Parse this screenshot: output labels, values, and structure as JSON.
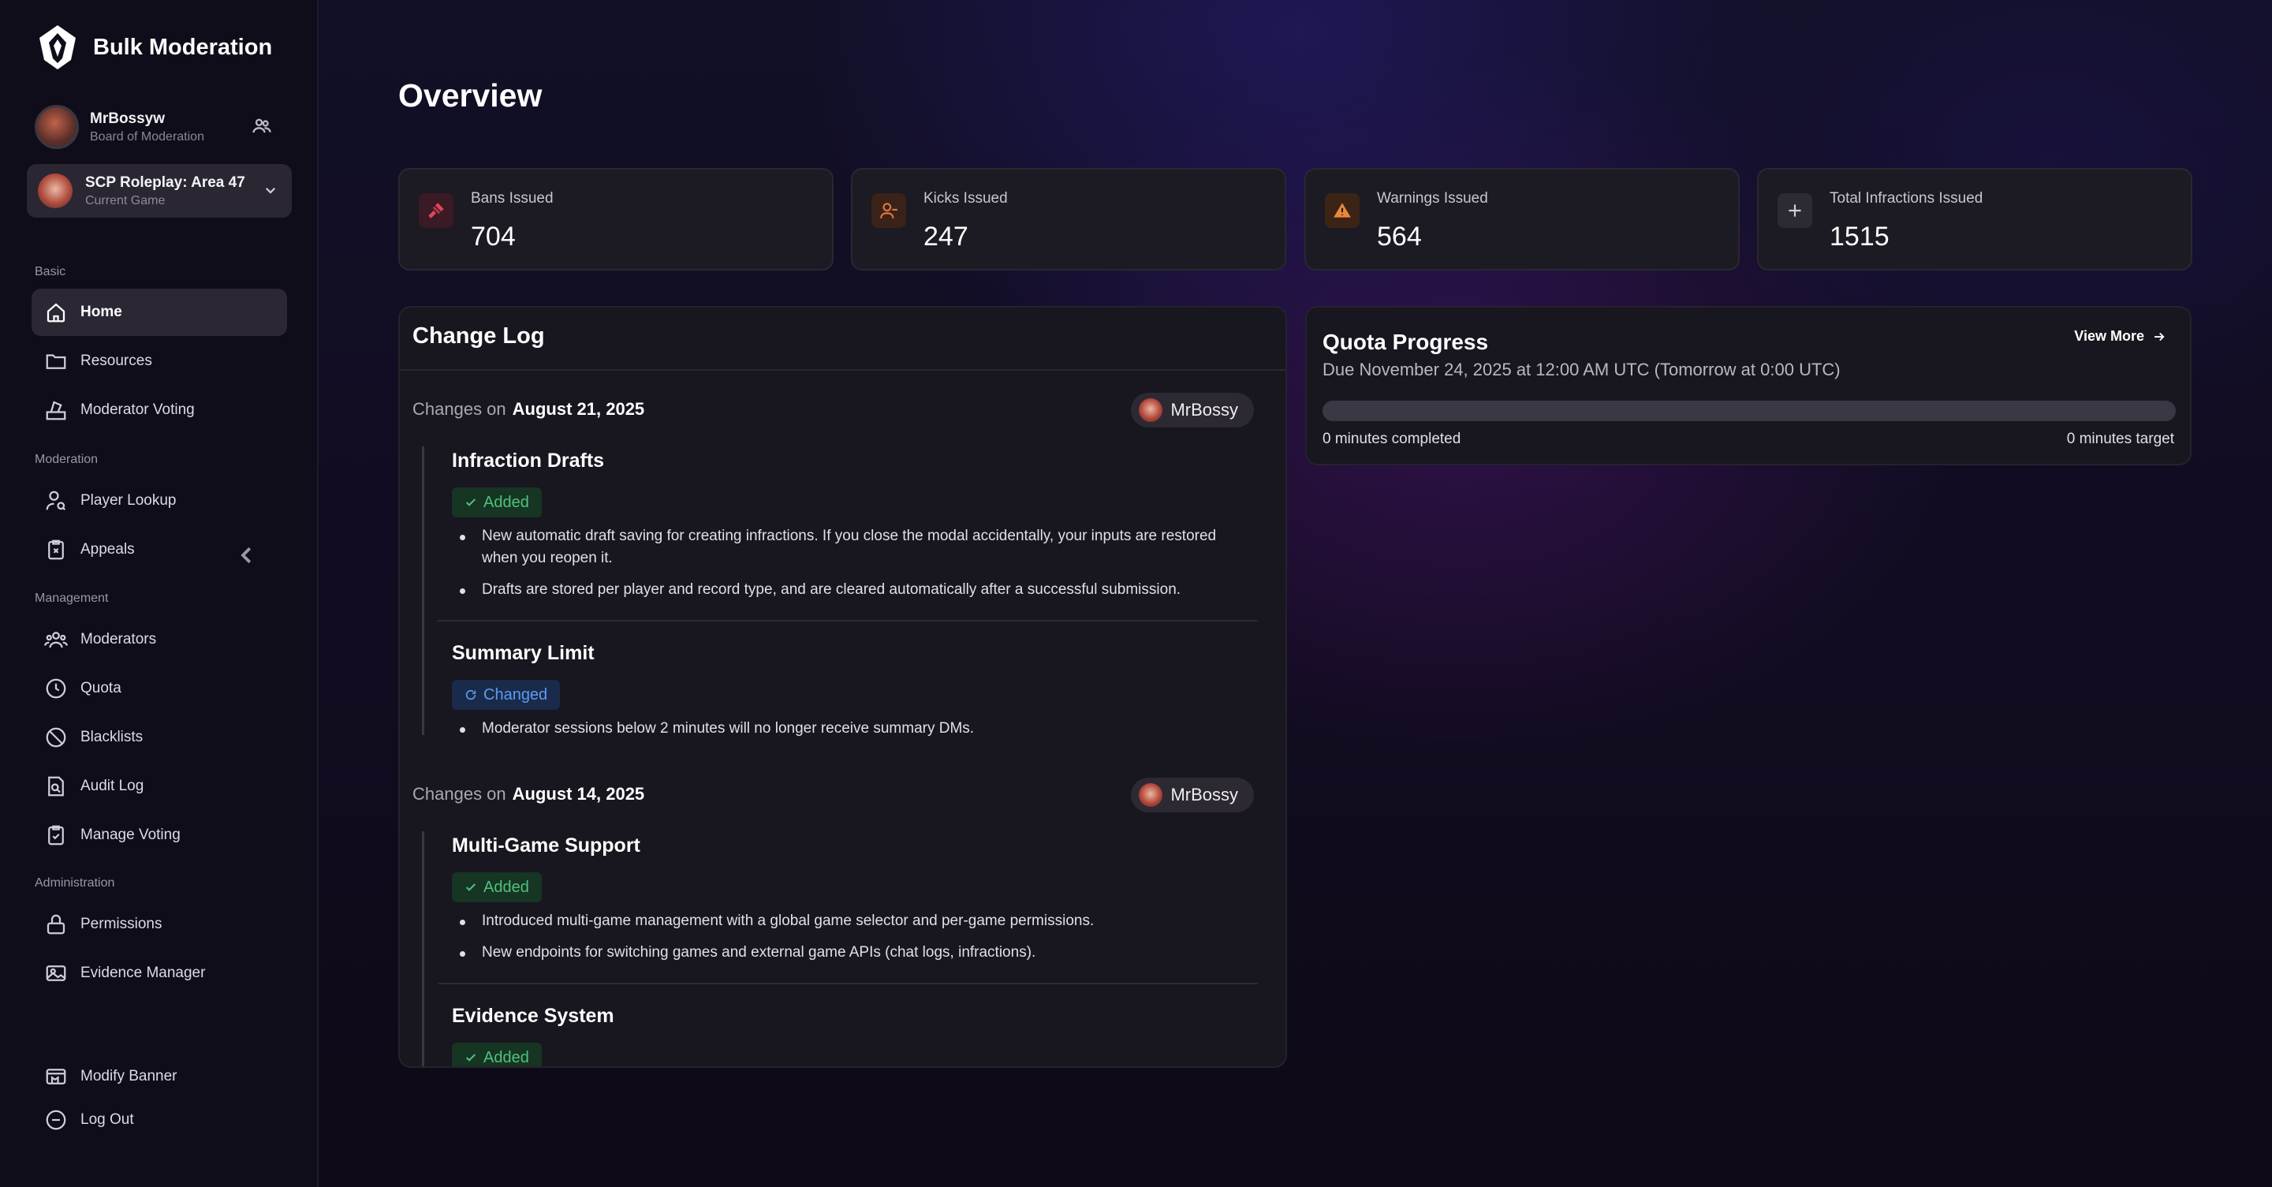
{
  "brand": {
    "name": "Bulk Moderation"
  },
  "user": {
    "name": "MrBossyw",
    "role": "Board of Moderation"
  },
  "game": {
    "title": "SCP Roleplay: Area 47",
    "subtitle": "Current Game"
  },
  "sidebar": {
    "sections": [
      "Basic",
      "Moderation",
      "Management",
      "Administration"
    ],
    "items": [
      {
        "label": "Home",
        "icon": "home-icon",
        "active": true
      },
      {
        "label": "Resources",
        "icon": "folder-icon"
      },
      {
        "label": "Moderator Voting",
        "icon": "ballot-box-icon"
      },
      {
        "label": "Player Lookup",
        "icon": "user-search-icon"
      },
      {
        "label": "Appeals",
        "icon": "clipboard-x-icon"
      },
      {
        "label": "Moderators",
        "icon": "users-icon"
      },
      {
        "label": "Quota",
        "icon": "clock-icon"
      },
      {
        "label": "Blacklists",
        "icon": "ban-icon"
      },
      {
        "label": "Audit Log",
        "icon": "file-search-icon"
      },
      {
        "label": "Manage Voting",
        "icon": "clipboard-check-icon"
      },
      {
        "label": "Permissions",
        "icon": "lock-icon"
      },
      {
        "label": "Evidence Manager",
        "icon": "image-icon"
      },
      {
        "label": "Modify Banner",
        "icon": "banner-icon"
      },
      {
        "label": "Log Out",
        "icon": "logout-icon"
      }
    ]
  },
  "page": {
    "title": "Overview"
  },
  "stats": [
    {
      "label": "Bans Issued",
      "value": "704",
      "icon": "gavel-icon",
      "color": "#e0455a"
    },
    {
      "label": "Kicks Issued",
      "value": "247",
      "icon": "user-minus-icon",
      "color": "#e0773c"
    },
    {
      "label": "Warnings Issued",
      "value": "564",
      "icon": "warning-icon",
      "color": "#e8883a"
    },
    {
      "label": "Total Infractions Issued",
      "value": "1515",
      "icon": "plus-icon",
      "color": "#cfcfd6"
    }
  ],
  "changelog": {
    "title": "Change Log",
    "prefix": "Changes on",
    "groups": [
      {
        "date": "August 21, 2025",
        "author": "MrBossy",
        "entries": [
          {
            "title": "Infraction Drafts",
            "badge": "Added",
            "bullets": [
              "New automatic draft saving for creating infractions. If you close the modal accidentally, your inputs are restored when you reopen it.",
              "Drafts are stored per player and record type, and are cleared automatically after a successful submission."
            ]
          },
          {
            "title": "Summary Limit",
            "badge": "Changed",
            "bullets": [
              "Moderator sessions below 2 minutes will no longer receive summary DMs."
            ]
          }
        ]
      },
      {
        "date": "August 14, 2025",
        "author": "MrBossy",
        "entries": [
          {
            "title": "Multi-Game Support",
            "badge": "Added",
            "bullets": [
              "Introduced multi-game management with a global game selector and per-game permissions.",
              "New endpoints for switching games and external game APIs (chat logs, infractions)."
            ]
          },
          {
            "title": "Evidence System",
            "badge": "Added",
            "bullets": []
          }
        ]
      }
    ]
  },
  "quota": {
    "title": "Quota Progress",
    "due": "Due November 24, 2025 at 12:00 AM UTC (Tomorrow at 0:00 UTC)",
    "view_more": "View More",
    "completed": "0 minutes completed",
    "target": "0 minutes target",
    "progress": 0
  }
}
